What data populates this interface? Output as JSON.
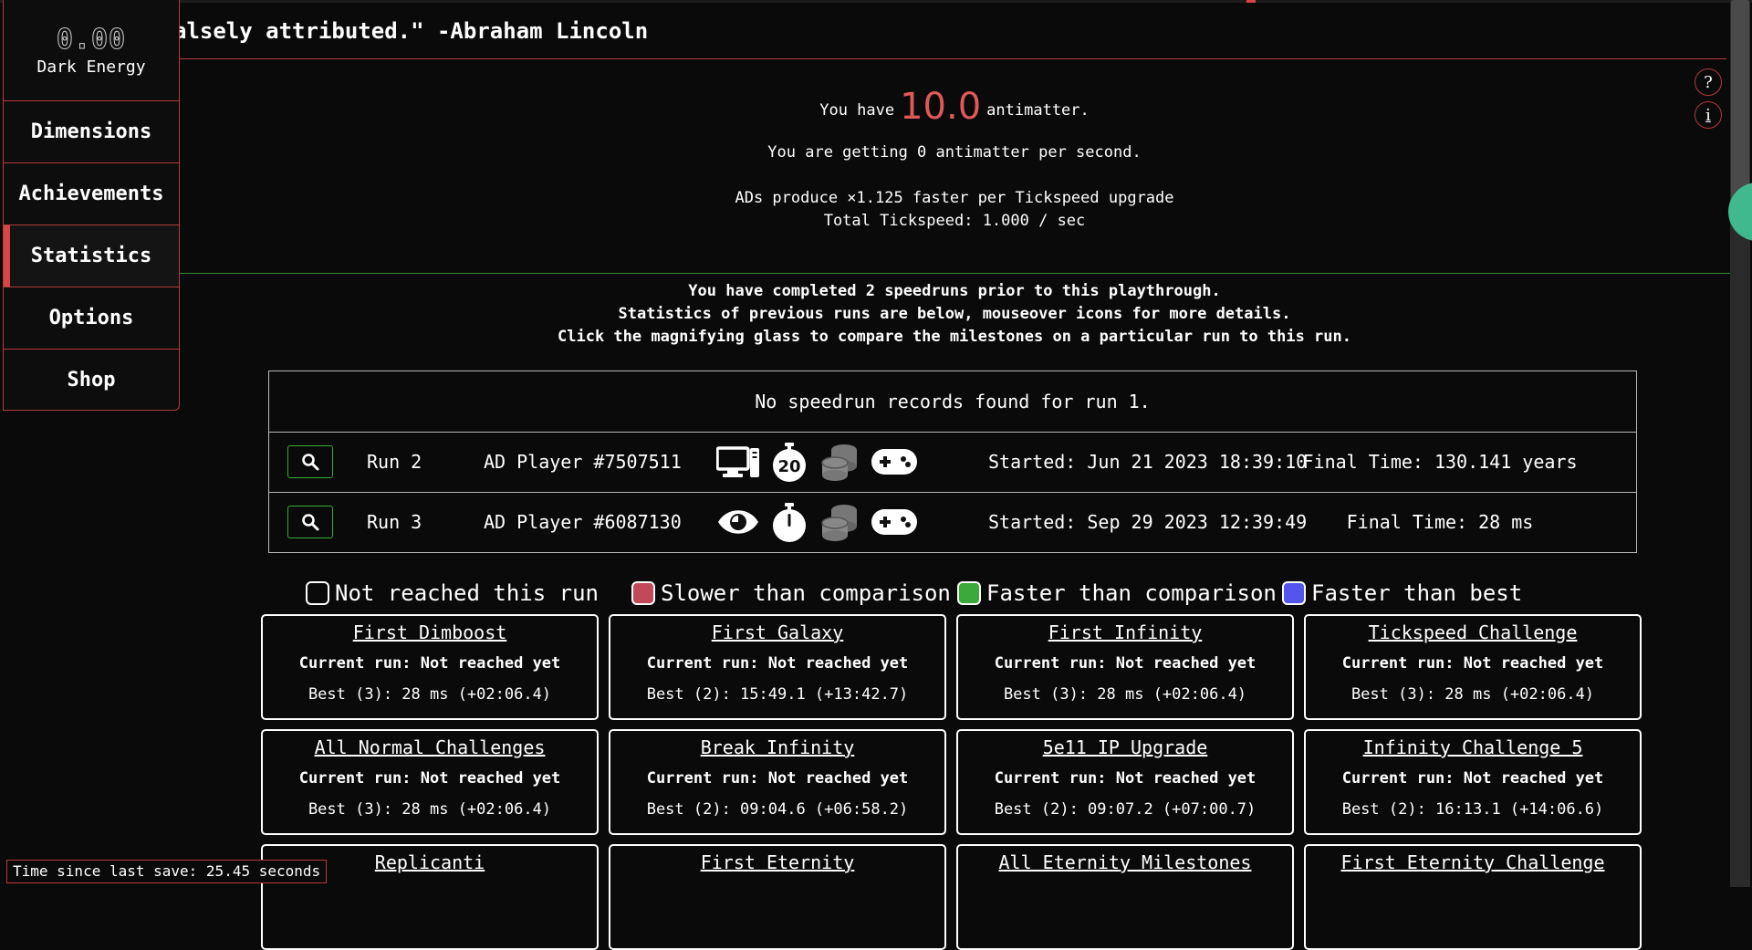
{
  "news": {
    "text": "alsely attributed.\" -Abraham Lincoln"
  },
  "sidebar": {
    "dark_energy_value": "0.00",
    "dark_energy_label": "Dark Energy",
    "items": [
      {
        "label": "Dimensions"
      },
      {
        "label": "Achievements"
      },
      {
        "label": "Statistics"
      },
      {
        "label": "Options"
      },
      {
        "label": "Shop"
      }
    ]
  },
  "header": {
    "you_have": "You have",
    "antimatter_value": "10.0",
    "antimatter_word": "antimatter.",
    "per_second": "You are getting 0 antimatter per second.",
    "tickspeed_mult": "ADs produce ×1.125 faster per Tickspeed upgrade",
    "total_tickspeed": "Total Tickspeed: 1.000 / sec"
  },
  "speedrun_info": {
    "line1": "You have completed 2 speedruns prior to this playthrough.",
    "line2": "Statistics of previous runs are below, mouseover icons for more details.",
    "line3": "Click the magnifying glass to compare the milestones on a particular run to this run."
  },
  "records": {
    "empty_message": "No speedrun records found for run 1.",
    "rows": [
      {
        "run": "Run 2",
        "player": "AD Player #7507511",
        "timer_badge": "20",
        "started": "Started: Jun 21 2023 18:39:10",
        "final": "Final Time: 130.141 years",
        "icons": [
          "computer-icon",
          "stopwatch-icon",
          "coins-icon",
          "gamepad-icon"
        ]
      },
      {
        "run": "Run 3",
        "player": "AD Player #6087130",
        "timer_badge": "",
        "started": "Started: Sep 29 2023 12:39:49",
        "final": "Final Time: 28 ms",
        "icons": [
          "eye-icon",
          "stopwatch-icon",
          "coins-icon",
          "gamepad-icon"
        ]
      }
    ]
  },
  "legend": [
    {
      "label": "Not reached this run",
      "color": "#0a0a0a"
    },
    {
      "label": "Slower than comparison",
      "color": "#c2495a"
    },
    {
      "label": "Faster than comparison",
      "color": "#3aa83a"
    },
    {
      "label": "Faster than best",
      "color": "#5555ee"
    }
  ],
  "milestones": [
    {
      "title": "First Dimboost",
      "current": "Current run: Not reached yet",
      "best": "Best (3): 28 ms (+02:06.4)"
    },
    {
      "title": "First Galaxy",
      "current": "Current run: Not reached yet",
      "best": "Best (2): 15:49.1 (+13:42.7)"
    },
    {
      "title": "First Infinity",
      "current": "Current run: Not reached yet",
      "best": "Best (3): 28 ms (+02:06.4)"
    },
    {
      "title": "Tickspeed Challenge",
      "current": "Current run: Not reached yet",
      "best": "Best (3): 28 ms (+02:06.4)"
    },
    {
      "title": "All Normal Challenges",
      "current": "Current run: Not reached yet",
      "best": "Best (3): 28 ms (+02:06.4)"
    },
    {
      "title": "Break Infinity",
      "current": "Current run: Not reached yet",
      "best": "Best (2): 09:04.6 (+06:58.2)"
    },
    {
      "title": "5e11 IP Upgrade",
      "current": "Current run: Not reached yet",
      "best": "Best (2): 09:07.2 (+07:00.7)"
    },
    {
      "title": "Infinity Challenge 5",
      "current": "Current run: Not reached yet",
      "best": "Best (2): 16:13.1 (+14:06.6)"
    },
    {
      "title": "Replicanti",
      "current": "",
      "best": ""
    },
    {
      "title": "First Eternity",
      "current": "",
      "best": ""
    },
    {
      "title": "All Eternity Milestones",
      "current": "",
      "best": ""
    },
    {
      "title": "First Eternity Challenge",
      "current": "",
      "best": ""
    }
  ],
  "footer": {
    "save_time": "Time since last save: 25.45 seconds"
  },
  "side_buttons": {
    "help": "?",
    "info": "i"
  },
  "colors": {
    "accent_red": "#d94545",
    "accent_green": "#38a838",
    "antimatter": "#e05858"
  }
}
